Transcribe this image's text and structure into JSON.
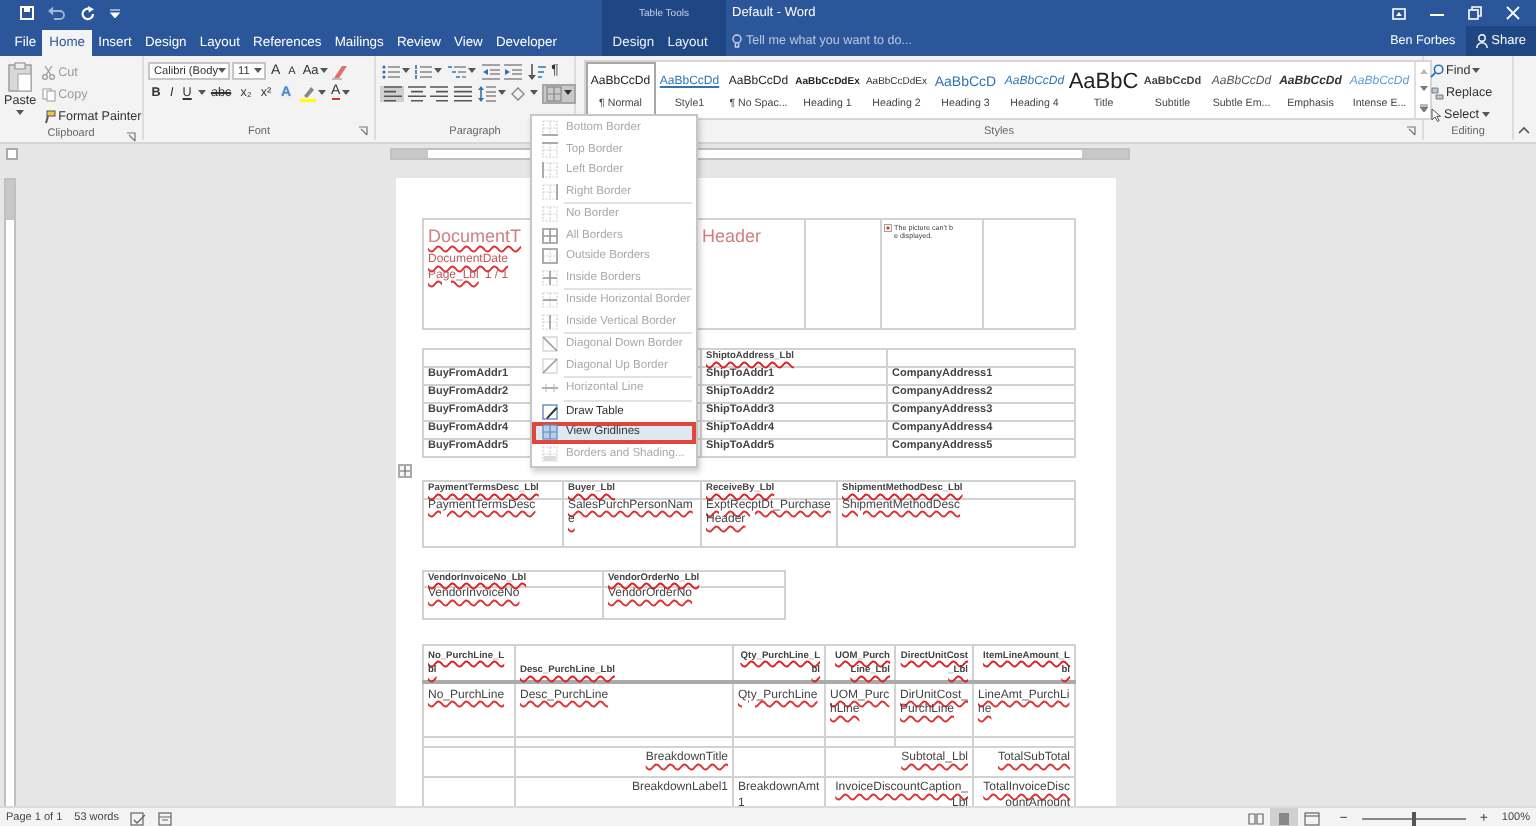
{
  "title_bar": {
    "context_label": "Table Tools",
    "title": "Default - Word"
  },
  "tabs": [
    {
      "label": "File",
      "selected": false,
      "contextual": false
    },
    {
      "label": "Home",
      "selected": true,
      "contextual": false
    },
    {
      "label": "Insert",
      "selected": false,
      "contextual": false
    },
    {
      "label": "Design",
      "selected": false,
      "contextual": false
    },
    {
      "label": "Layout",
      "selected": false,
      "contextual": false
    },
    {
      "label": "References",
      "selected": false,
      "contextual": false
    },
    {
      "label": "Mailings",
      "selected": false,
      "contextual": false
    },
    {
      "label": "Review",
      "selected": false,
      "contextual": false
    },
    {
      "label": "View",
      "selected": false,
      "contextual": false
    },
    {
      "label": "Developer",
      "selected": false,
      "contextual": false
    },
    {
      "label": "Design",
      "selected": false,
      "contextual": true
    },
    {
      "label": "Layout",
      "selected": false,
      "contextual": true
    }
  ],
  "tell_me": {
    "placeholder": "Tell me what you want to do..."
  },
  "user": "Ben Forbes",
  "share": "Share",
  "ribbon": {
    "clipboard": {
      "paste": "Paste",
      "actions": [
        {
          "label": "Cut",
          "disabled": true
        },
        {
          "label": "Copy",
          "disabled": true
        },
        {
          "label": "Format Painter",
          "disabled": false
        }
      ],
      "label": "Clipboard"
    },
    "font": {
      "name": "Calibri (Body",
      "size": "11",
      "grow": "A",
      "shrink": "A",
      "change_case": "Aa",
      "format_buttons": [
        {
          "label": "B",
          "kind": "bold"
        },
        {
          "label": "I",
          "kind": "italic"
        },
        {
          "label": "U",
          "kind": "underline"
        },
        {
          "label": "abc",
          "kind": "strike"
        },
        {
          "label": "x₂",
          "kind": "plain"
        },
        {
          "label": "x²",
          "kind": "plain"
        }
      ],
      "text_effects": "A",
      "font_color": "A",
      "label": "Font"
    },
    "paragraph": {
      "show_marks": "¶",
      "label": "Paragraph"
    },
    "styles": {
      "items": [
        {
          "preview": "AaBbCcDd",
          "name": "¶ Normal",
          "kind": "normal",
          "selected": true
        },
        {
          "preview": "AaBbCcDd",
          "name": "Style1",
          "kind": "link",
          "selected": false
        },
        {
          "preview": "AaBbCcDd",
          "name": "¶ No Spac...",
          "kind": "normal",
          "selected": false
        },
        {
          "preview": "AaBbCcDdEx",
          "name": "Heading 1",
          "kind": "heading1",
          "selected": false
        },
        {
          "preview": "AaBbCcDdEx",
          "name": "Heading 2",
          "kind": "heading2",
          "selected": false
        },
        {
          "preview": "AaBbCcD",
          "name": "Heading 3",
          "kind": "heading3",
          "selected": false
        },
        {
          "preview": "AaBbCcDd",
          "name": "Heading 4",
          "kind": "heading4",
          "selected": false
        },
        {
          "preview": "AaBbC",
          "name": "Title",
          "kind": "title",
          "selected": false
        },
        {
          "preview": "AaBbCcDd",
          "name": "Subtitle",
          "kind": "subtitle",
          "selected": false
        },
        {
          "preview": "AaBbCcDd",
          "name": "Subtle Em...",
          "kind": "subtle",
          "selected": false
        },
        {
          "preview": "AaBbCcDd",
          "name": "Emphasis",
          "kind": "emphasis",
          "selected": false
        },
        {
          "preview": "AaBbCcDd",
          "name": "Intense E...",
          "kind": "intense",
          "selected": false
        }
      ],
      "label": "Styles"
    },
    "editing": {
      "find": "Find",
      "replace": "Replace",
      "select": "Select",
      "label": "Editing"
    }
  },
  "border_menu": {
    "open": true,
    "groups": [
      [
        {
          "label": "Bottom Border",
          "disabled": true,
          "highlighted": false
        },
        {
          "label": "Top Border",
          "disabled": true,
          "highlighted": false
        },
        {
          "label": "Left Border",
          "disabled": true,
          "highlighted": false
        },
        {
          "label": "Right Border",
          "disabled": true,
          "highlighted": false
        }
      ],
      [
        {
          "label": "No Border",
          "disabled": true,
          "highlighted": false
        },
        {
          "label": "All Borders",
          "disabled": true,
          "highlighted": false
        },
        {
          "label": "Outside Borders",
          "disabled": true,
          "highlighted": false
        },
        {
          "label": "Inside Borders",
          "disabled": true,
          "highlighted": false
        }
      ],
      [
        {
          "label": "Inside Horizontal Border",
          "disabled": true,
          "highlighted": false
        },
        {
          "label": "Inside Vertical Border",
          "disabled": true,
          "highlighted": false
        }
      ],
      [
        {
          "label": "Diagonal Down Border",
          "disabled": true,
          "highlighted": false
        },
        {
          "label": "Diagonal Up Border",
          "disabled": true,
          "highlighted": false
        }
      ],
      [
        {
          "label": "Horizontal Line",
          "disabled": true,
          "highlighted": false
        }
      ],
      [
        {
          "label": "Draw Table",
          "disabled": false,
          "highlighted": false
        },
        {
          "label": "View Gridlines",
          "disabled": false,
          "highlighted": true
        },
        {
          "label": "Borders and Shading...",
          "disabled": true,
          "highlighted": false
        }
      ]
    ]
  },
  "document": {
    "header": {
      "title_start": {
        "text": "DocumentT",
        "flagged": true
      },
      "title_end": {
        "text": "Header",
        "flagged": false
      },
      "date": {
        "text": "DocumentDate",
        "flagged": true
      },
      "page_label": {
        "text": "Page_Lbl",
        "flagged": true
      },
      "page_value": {
        "text": "1 / 1",
        "flagged": false
      },
      "picture_note": "The picture can't be displayed."
    },
    "address_table": {
      "ship_to_label": {
        "text": "ShiptoAddress_Lbl",
        "flagged": true
      },
      "rows": [
        [
          "BuyFromAddr1",
          "ShipToAddr1",
          "CompanyAddress1"
        ],
        [
          "BuyFromAddr2",
          "ShipToAddr2",
          "CompanyAddress2"
        ],
        [
          "BuyFromAddr3",
          "ShipToAddr3",
          "CompanyAddress3"
        ],
        [
          "BuyFromAddr4",
          "ShipToAddr4",
          "CompanyAddress4"
        ],
        [
          "BuyFromAddr5",
          "ShipToAddr5",
          "CompanyAddress5"
        ]
      ]
    },
    "terms_table": [
      {
        "label": {
          "text": "PaymentTermsDesc_Lbl",
          "flagged": true
        },
        "value": {
          "text": "PaymentTermsDesc",
          "flagged": true
        }
      },
      {
        "label": {
          "text": "Buyer_Lbl",
          "flagged": true
        },
        "value": {
          "text": "SalesPurchPersonName",
          "flagged": true
        }
      },
      {
        "label": {
          "text": "ReceiveBy_Lbl",
          "flagged": true
        },
        "value": {
          "text": "ExptRecptDt_PurchaseHeader",
          "flagged": true
        }
      },
      {
        "label": {
          "text": "ShipmentMethodDesc_Lbl",
          "flagged": true
        },
        "value": {
          "text": "ShipmentMethodDesc",
          "flagged": true
        }
      }
    ],
    "vendor_table": [
      {
        "label": {
          "text": "VendorInvoiceNo_Lbl",
          "flagged": true
        },
        "value": {
          "text": "VendorInvoiceNo",
          "flagged": true
        }
      },
      {
        "label": {
          "text": "VendorOrderNo_Lbl",
          "flagged": true
        },
        "value": {
          "text": "VendorOrderNo",
          "flagged": true
        }
      }
    ],
    "lines_table": {
      "columns": [
        {
          "text": "No_PurchLine_Lbl",
          "flagged": true
        },
        {
          "text": "Desc_PurchLine_Lbl",
          "flagged": true
        },
        {
          "text": "Qty_PurchLine_Lbl",
          "flagged": true
        },
        {
          "text": "UOM_PurchLine_Lbl",
          "flagged": true
        },
        {
          "text": "DirectUnitCost_Lbl",
          "flagged": true
        },
        {
          "text": "ItemLineAmount_Lbl",
          "flagged": true
        }
      ],
      "line": [
        {
          "text": "No_PurchLine",
          "flagged": true
        },
        {
          "text": "Desc_PurchLine",
          "flagged": true
        },
        {
          "text": "Qty_PurchLine",
          "flagged": true
        },
        {
          "text": "UOM_PurchLine",
          "flagged": true
        },
        {
          "text": "DirUnitCost_PurchLine",
          "flagged": true
        },
        {
          "text": "LineAmt_PurchLine",
          "flagged": true
        }
      ],
      "breakdown": [
        {
          "title": {
            "text": "BreakdownTitle",
            "flagged": true
          },
          "label": {
            "text": "Subtotal_Lbl",
            "flagged": true
          },
          "total": {
            "text": "TotalSubTotal",
            "flagged": true
          }
        },
        {
          "title": {
            "text": "BreakdownLabel1",
            "flagged": false
          },
          "amount": {
            "text": "BreakdownAmt1",
            "flagged": false
          },
          "label": {
            "text": "InvoiceDiscountCaption_Lbl",
            "flagged": true
          },
          "total": {
            "text": "TotalInvoiceDiscountAmount",
            "flagged": true
          }
        }
      ]
    }
  },
  "status_bar": {
    "page": "Page 1 of 1",
    "words": "53 words",
    "views": [
      {
        "kind": "read",
        "selected": false
      },
      {
        "kind": "print",
        "selected": true
      },
      {
        "kind": "web",
        "selected": false
      }
    ],
    "zoom_out": "−",
    "zoom_in": "+",
    "zoom": {
      "level": 0.5,
      "reading": "100%"
    }
  }
}
